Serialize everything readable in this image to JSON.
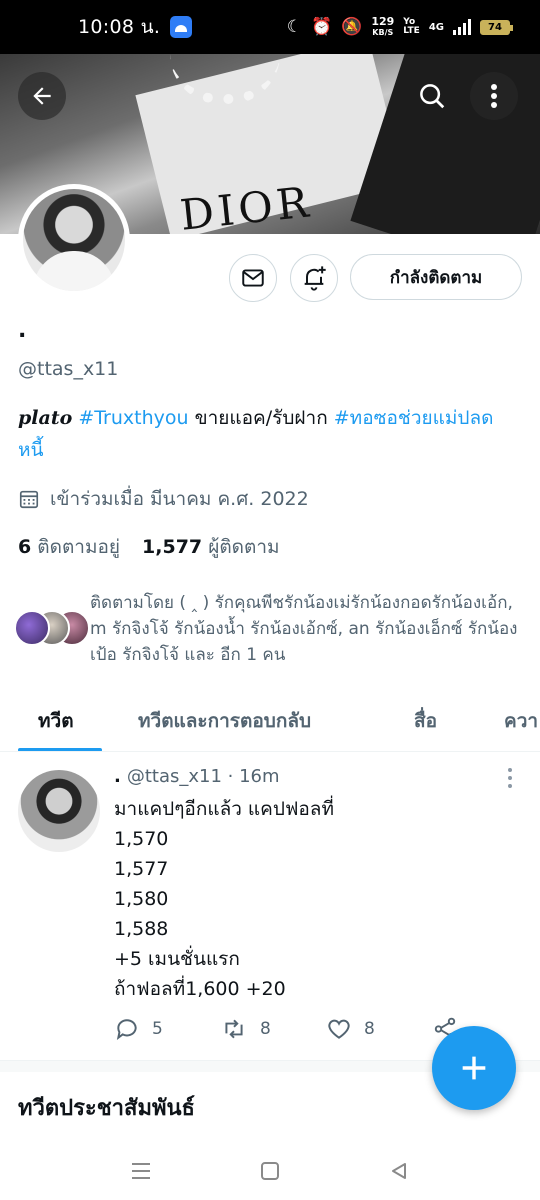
{
  "status_bar": {
    "time": "10:08 น.",
    "net_speed_value": "129",
    "net_speed_unit": "KB/S",
    "volte_top": "Yo",
    "volte_bottom": "LTE",
    "network": "4G",
    "battery": "74"
  },
  "banner": {
    "brand_text": "DIOR"
  },
  "profile": {
    "display_name": ".",
    "handle": "@ttas_x11",
    "bio_plato": "plato",
    "bio_tag1": "#Truxthyou",
    "bio_middle": " ขายแอค/รับฝาก ",
    "bio_tag2": "#ทอซอช่วยแม่ปลดหนี้",
    "joined": "เข้าร่วมเมื่อ มีนาคม ค.ศ. 2022",
    "following_count": "6",
    "following_label": "ติดตามอยู่",
    "followers_count": "1,577",
    "followers_label": "ผู้ติดตาม",
    "follow_button": "กำลังติดตาม",
    "followed_by_text": "ติดตามโดย ( ‸ ) รักคุณพีชรักน้องเม่รักน้องกอดรักน้องเอ้ก, m รักจิงโจ้ รักน้องน้ำ รักน้องเอ้กซ์, an รักน้องเอ็กซ์ รักน้องเป้อ รักจิงโจ้ และ อีก 1 คน"
  },
  "tabs": [
    {
      "label": "ทวีต",
      "active": true
    },
    {
      "label": "ทวีตและการตอบกลับ",
      "active": false
    },
    {
      "label": "สื่อ",
      "active": false
    },
    {
      "label": "ควา",
      "active": false
    }
  ],
  "tweet": {
    "name": ".",
    "handle_time": "@ttas_x11 · 16m",
    "lines": [
      "มาแคปๆอีกแล้ว แคปฟอลที่",
      "1,570",
      "1,577",
      "1,580",
      "1,588",
      "+5 เมนชั่นแรก",
      "ถ้าฟอลที่1,600 +20"
    ],
    "replies": "5",
    "retweets": "8",
    "likes": "8"
  },
  "section_title": "ทวีตประชาสัมพันธ์",
  "colors": {
    "accent": "#1d9bf0",
    "text_secondary": "#536471",
    "border": "#cfd9de"
  }
}
